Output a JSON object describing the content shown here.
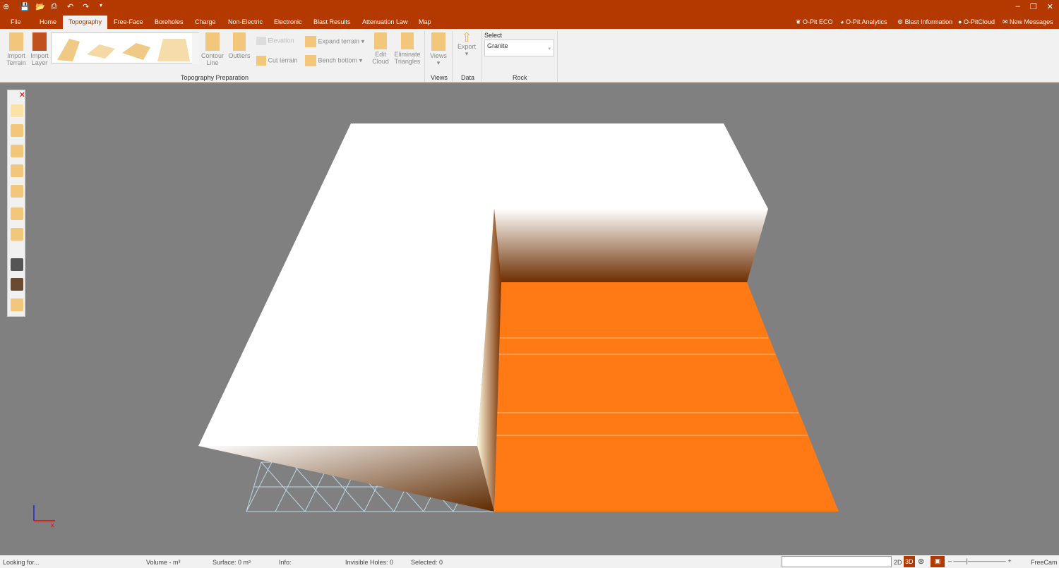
{
  "window": {
    "minimize": "–",
    "restore": "❐",
    "close": "✕"
  },
  "tabs": [
    "File",
    "Home",
    "Topography",
    "Free-Face",
    "Boreholes",
    "Charge",
    "Non-Electric",
    "Electronic",
    "Blast Results",
    "Attenuation Law",
    "Map"
  ],
  "active_tab": "Topography",
  "right_links": [
    "O-Pit ECO",
    "O-Pit Analytics",
    "Blast Information",
    "O-PitCloud",
    "New Messages"
  ],
  "ribbon": {
    "import_terrain": "Import Terrain",
    "import_layer": "Import Layer",
    "contour_line": "Contour Line",
    "outliers": "Outliers",
    "elevation": "Elevation",
    "cut_terrain": "Cut terrain",
    "expand_terrain": "Expand terrain",
    "bench_bottom": "Bench bottom",
    "edit_cloud": "Edit Cloud",
    "eliminate_triangles": "Eliminate Triangles",
    "views": "Views",
    "export": "Export",
    "select_label": "Select",
    "rock_value": "Granite",
    "groups": {
      "topography": "Topography Preparation",
      "views": "Views",
      "data": "Data",
      "rock": "Rock"
    }
  },
  "status": {
    "looking": "Looking for...",
    "volume": "Volume - m³",
    "surface": "Surface: 0 m²",
    "info": "Info:",
    "holes": "Invisible Holes: 0",
    "selected": "Selected: 0",
    "mode2d": "2D",
    "mode3d": "3D",
    "camera": "FreeCam"
  },
  "colors": {
    "accent": "#b33900",
    "floor": "#ff7a14"
  }
}
